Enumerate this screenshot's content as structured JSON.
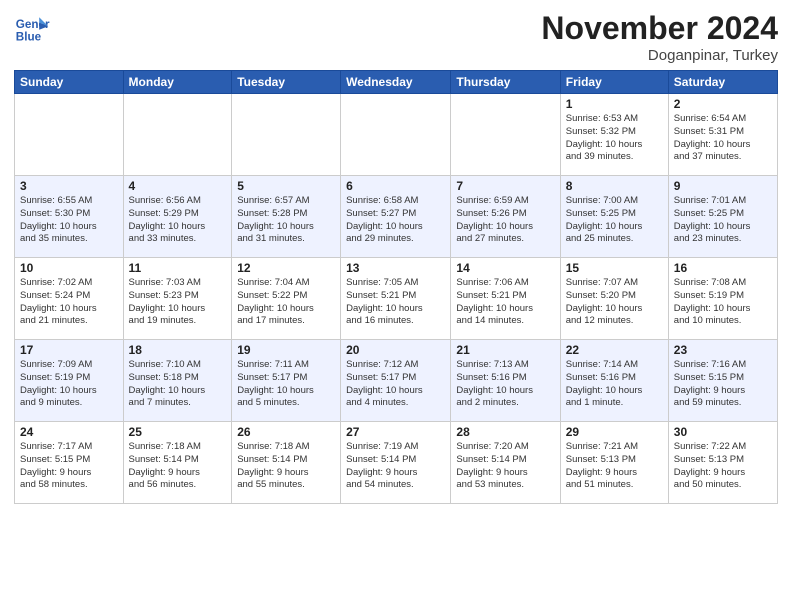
{
  "header": {
    "logo_line1": "General",
    "logo_line2": "Blue",
    "title": "November 2024",
    "location": "Doganpinar, Turkey"
  },
  "weekdays": [
    "Sunday",
    "Monday",
    "Tuesday",
    "Wednesday",
    "Thursday",
    "Friday",
    "Saturday"
  ],
  "weeks": [
    [
      {
        "day": "",
        "info": ""
      },
      {
        "day": "",
        "info": ""
      },
      {
        "day": "",
        "info": ""
      },
      {
        "day": "",
        "info": ""
      },
      {
        "day": "",
        "info": ""
      },
      {
        "day": "1",
        "info": "Sunrise: 6:53 AM\nSunset: 5:32 PM\nDaylight: 10 hours\nand 39 minutes."
      },
      {
        "day": "2",
        "info": "Sunrise: 6:54 AM\nSunset: 5:31 PM\nDaylight: 10 hours\nand 37 minutes."
      }
    ],
    [
      {
        "day": "3",
        "info": "Sunrise: 6:55 AM\nSunset: 5:30 PM\nDaylight: 10 hours\nand 35 minutes."
      },
      {
        "day": "4",
        "info": "Sunrise: 6:56 AM\nSunset: 5:29 PM\nDaylight: 10 hours\nand 33 minutes."
      },
      {
        "day": "5",
        "info": "Sunrise: 6:57 AM\nSunset: 5:28 PM\nDaylight: 10 hours\nand 31 minutes."
      },
      {
        "day": "6",
        "info": "Sunrise: 6:58 AM\nSunset: 5:27 PM\nDaylight: 10 hours\nand 29 minutes."
      },
      {
        "day": "7",
        "info": "Sunrise: 6:59 AM\nSunset: 5:26 PM\nDaylight: 10 hours\nand 27 minutes."
      },
      {
        "day": "8",
        "info": "Sunrise: 7:00 AM\nSunset: 5:25 PM\nDaylight: 10 hours\nand 25 minutes."
      },
      {
        "day": "9",
        "info": "Sunrise: 7:01 AM\nSunset: 5:25 PM\nDaylight: 10 hours\nand 23 minutes."
      }
    ],
    [
      {
        "day": "10",
        "info": "Sunrise: 7:02 AM\nSunset: 5:24 PM\nDaylight: 10 hours\nand 21 minutes."
      },
      {
        "day": "11",
        "info": "Sunrise: 7:03 AM\nSunset: 5:23 PM\nDaylight: 10 hours\nand 19 minutes."
      },
      {
        "day": "12",
        "info": "Sunrise: 7:04 AM\nSunset: 5:22 PM\nDaylight: 10 hours\nand 17 minutes."
      },
      {
        "day": "13",
        "info": "Sunrise: 7:05 AM\nSunset: 5:21 PM\nDaylight: 10 hours\nand 16 minutes."
      },
      {
        "day": "14",
        "info": "Sunrise: 7:06 AM\nSunset: 5:21 PM\nDaylight: 10 hours\nand 14 minutes."
      },
      {
        "day": "15",
        "info": "Sunrise: 7:07 AM\nSunset: 5:20 PM\nDaylight: 10 hours\nand 12 minutes."
      },
      {
        "day": "16",
        "info": "Sunrise: 7:08 AM\nSunset: 5:19 PM\nDaylight: 10 hours\nand 10 minutes."
      }
    ],
    [
      {
        "day": "17",
        "info": "Sunrise: 7:09 AM\nSunset: 5:19 PM\nDaylight: 10 hours\nand 9 minutes."
      },
      {
        "day": "18",
        "info": "Sunrise: 7:10 AM\nSunset: 5:18 PM\nDaylight: 10 hours\nand 7 minutes."
      },
      {
        "day": "19",
        "info": "Sunrise: 7:11 AM\nSunset: 5:17 PM\nDaylight: 10 hours\nand 5 minutes."
      },
      {
        "day": "20",
        "info": "Sunrise: 7:12 AM\nSunset: 5:17 PM\nDaylight: 10 hours\nand 4 minutes."
      },
      {
        "day": "21",
        "info": "Sunrise: 7:13 AM\nSunset: 5:16 PM\nDaylight: 10 hours\nand 2 minutes."
      },
      {
        "day": "22",
        "info": "Sunrise: 7:14 AM\nSunset: 5:16 PM\nDaylight: 10 hours\nand 1 minute."
      },
      {
        "day": "23",
        "info": "Sunrise: 7:16 AM\nSunset: 5:15 PM\nDaylight: 9 hours\nand 59 minutes."
      }
    ],
    [
      {
        "day": "24",
        "info": "Sunrise: 7:17 AM\nSunset: 5:15 PM\nDaylight: 9 hours\nand 58 minutes."
      },
      {
        "day": "25",
        "info": "Sunrise: 7:18 AM\nSunset: 5:14 PM\nDaylight: 9 hours\nand 56 minutes."
      },
      {
        "day": "26",
        "info": "Sunrise: 7:18 AM\nSunset: 5:14 PM\nDaylight: 9 hours\nand 55 minutes."
      },
      {
        "day": "27",
        "info": "Sunrise: 7:19 AM\nSunset: 5:14 PM\nDaylight: 9 hours\nand 54 minutes."
      },
      {
        "day": "28",
        "info": "Sunrise: 7:20 AM\nSunset: 5:14 PM\nDaylight: 9 hours\nand 53 minutes."
      },
      {
        "day": "29",
        "info": "Sunrise: 7:21 AM\nSunset: 5:13 PM\nDaylight: 9 hours\nand 51 minutes."
      },
      {
        "day": "30",
        "info": "Sunrise: 7:22 AM\nSunset: 5:13 PM\nDaylight: 9 hours\nand 50 minutes."
      }
    ]
  ]
}
